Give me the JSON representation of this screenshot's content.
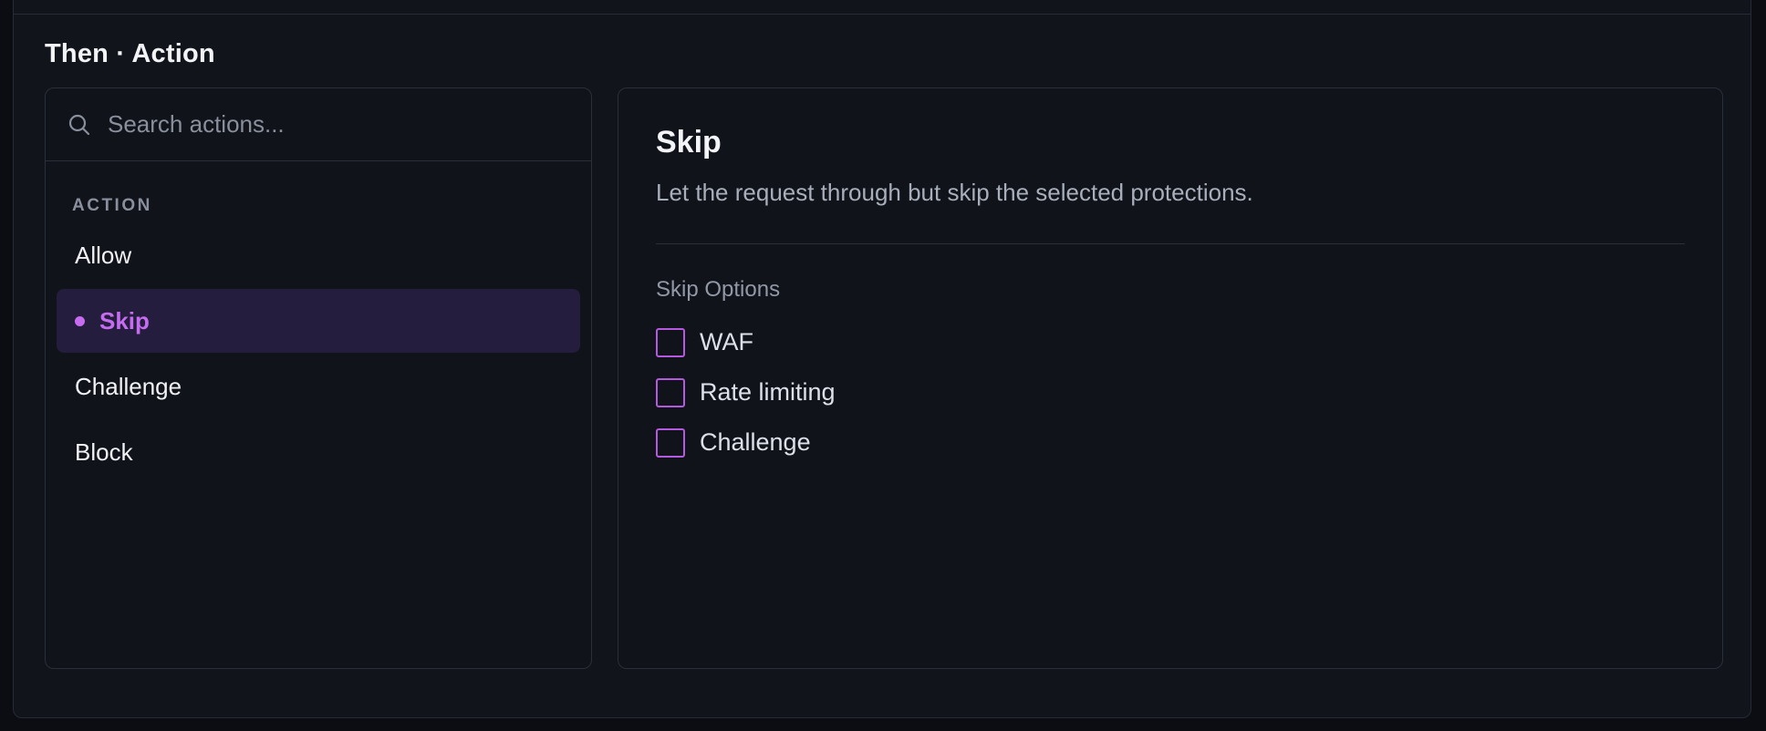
{
  "section": {
    "title": "Then · Action"
  },
  "search": {
    "placeholder": "Search actions..."
  },
  "list": {
    "group_label": "ACTION",
    "items": [
      {
        "label": "Allow"
      },
      {
        "label": "Skip"
      },
      {
        "label": "Challenge"
      },
      {
        "label": "Block"
      }
    ],
    "selected_index": 1
  },
  "detail": {
    "title": "Skip",
    "description": "Let the request through but skip the selected protections.",
    "options_label": "Skip Options",
    "options": [
      {
        "label": "WAF",
        "checked": false
      },
      {
        "label": "Rate limiting",
        "checked": false
      },
      {
        "label": "Challenge",
        "checked": false
      }
    ]
  },
  "colors": {
    "accent": "#c56cf0",
    "selected_bg": "#241d3d",
    "panel_bg": "#10131a",
    "border": "#2b2f3a"
  },
  "icons": {
    "search": "search-icon",
    "selected_marker": "dot"
  }
}
